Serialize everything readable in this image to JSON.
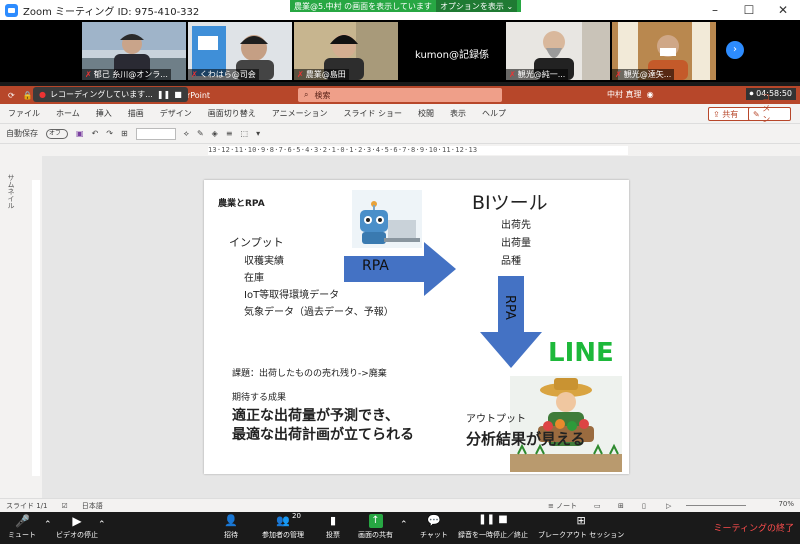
{
  "zoom": {
    "title": "Zoom ミーティング ID: 975-410-332",
    "share_banner": "農業@5.中村 の画面を表示しています",
    "options_label": "オプションを表示",
    "participants": [
      {
        "name": "郁己 糸川@オンラ..."
      },
      {
        "name": "くわはら@司会"
      },
      {
        "name": "農業@島田"
      },
      {
        "name": "kumon@記録係"
      },
      {
        "name": "観光@純一..."
      },
      {
        "name": "観光@達矢..."
      }
    ],
    "toolbar": {
      "mute": "ミュート",
      "video": "ビデオの停止",
      "invite": "招待",
      "participants": "参加者の管理",
      "participants_count": "20",
      "poll": "投票",
      "share": "画面の共有",
      "chat": "チャット",
      "record": "録音を一時停止／終止",
      "breakout": "ブレークアウト セッション",
      "end": "ミーティングの終了"
    }
  },
  "ppt": {
    "recording_pill": "レコーディングしています...",
    "app_name": "PowerPoint",
    "search_placeholder": "検索",
    "user": "中村 真理",
    "timer": "04:58:50",
    "menu": [
      "ファイル",
      "ホーム",
      "挿入",
      "描画",
      "デザイン",
      "画面切り替え",
      "アニメーション",
      "スライド ショー",
      "校閲",
      "表示",
      "ヘルプ"
    ],
    "share_btn": "共有",
    "comment_btn": "コメント",
    "autosave": "自動保存",
    "autosave_state": "オフ",
    "thumbs_label": "サムネイル",
    "ruler_text": "13·12·11·10·9·8·7·6·5·4·3·2·1·0·1·2·3·4·5·6·7·8·9·10·11·12·13",
    "status": {
      "slide": "スライド 1/1",
      "lang": "日本語",
      "notes": "ノート",
      "zoom": "70%"
    }
  },
  "slide": {
    "title": "農業とRPA",
    "input_heading": "インプット",
    "inputs": [
      "収穫実績",
      "在庫",
      "IoT等取得環境データ",
      "気象データ（過去データ、予報）"
    ],
    "rpa_arrow_label": "RPA",
    "bi_title": "BIツール",
    "bi_items": [
      "出荷先",
      "出荷量",
      "品種"
    ],
    "rpa_down_label": "RPA",
    "line_logo": "LINE",
    "issue": "課題：出荷したものの売れ残り->廃棄",
    "expected_heading": "期待する成果",
    "expected_line1": "適正な出荷量が予測でき、",
    "expected_line2": "最適な出荷計画が立てられる",
    "output_heading": "アウトプット",
    "output_main": "分析結果が見える"
  }
}
